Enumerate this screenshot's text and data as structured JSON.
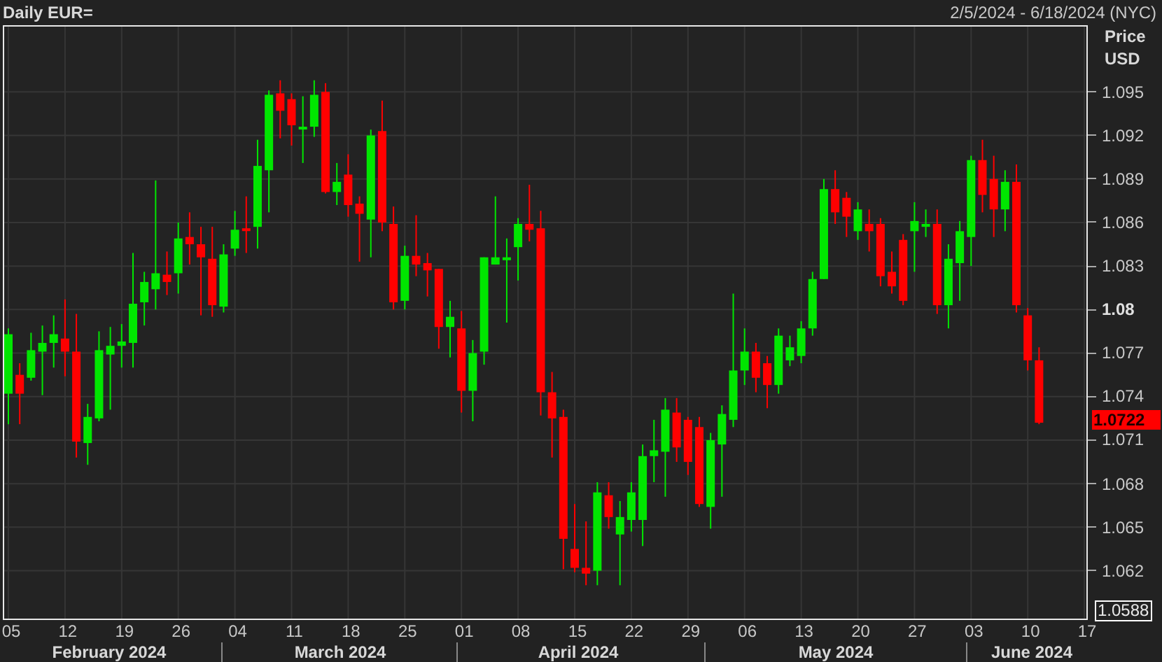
{
  "header": {
    "title": "Daily EUR=",
    "range": "2/5/2024 - 6/18/2024 (NYC)"
  },
  "price_axis": {
    "title": "Price",
    "unit": "USD",
    "tick_styles": [
      {
        "major": false
      },
      {
        "major": false
      },
      {
        "major": false
      },
      {
        "major": false
      },
      {
        "major": false
      },
      {
        "major": true
      },
      {
        "major": false
      },
      {
        "major": false
      },
      {
        "major": false
      },
      {
        "major": false
      },
      {
        "major": false
      },
      {
        "major": false
      }
    ],
    "last_price": "1.0722",
    "low_marker": "1.0588"
  },
  "chart_data": {
    "type": "candlestick",
    "categories": [
      "05",
      null,
      null,
      null,
      null,
      "12",
      null,
      null,
      null,
      null,
      "19",
      null,
      null,
      null,
      null,
      "26",
      null,
      null,
      null,
      null,
      "04",
      null,
      null,
      null,
      null,
      "11",
      null,
      null,
      null,
      null,
      "18",
      null,
      null,
      null,
      null,
      "25",
      null,
      null,
      null,
      null,
      "01",
      null,
      null,
      null,
      null,
      "08",
      null,
      null,
      null,
      null,
      "15",
      null,
      null,
      null,
      null,
      "22",
      null,
      null,
      null,
      null,
      "29",
      null,
      null,
      null,
      null,
      "06",
      null,
      null,
      null,
      null,
      "13",
      null,
      null,
      null,
      null,
      "20",
      null,
      null,
      null,
      null,
      "27",
      null,
      null,
      null,
      null,
      "03",
      null,
      null,
      null,
      null,
      "10",
      null
    ],
    "ylim": [
      1.0587,
      1.0995
    ],
    "grid": true,
    "yticks": [
      {
        "value": 1.095,
        "label": "1.095"
      },
      {
        "value": 1.092,
        "label": "1.092"
      },
      {
        "value": 1.089,
        "label": "1.089"
      },
      {
        "value": 1.086,
        "label": "1.086"
      },
      {
        "value": 1.083,
        "label": "1.083"
      },
      {
        "value": 1.08,
        "label": "1.08"
      },
      {
        "value": 1.077,
        "label": "1.077"
      },
      {
        "value": 1.074,
        "label": "1.074"
      },
      {
        "value": 1.071,
        "label": "1.071"
      },
      {
        "value": 1.068,
        "label": "1.068"
      },
      {
        "value": 1.065,
        "label": "1.065"
      },
      {
        "value": 1.062,
        "label": "1.062"
      }
    ],
    "ohlc": [
      [
        1.0742,
        1.0787,
        1.0721,
        1.0783
      ],
      [
        1.0755,
        1.0763,
        1.0721,
        1.0742
      ],
      [
        1.0753,
        1.0784,
        1.0751,
        1.0772
      ],
      [
        1.0771,
        1.0789,
        1.0741,
        1.0777
      ],
      [
        1.0777,
        1.0796,
        1.076,
        1.0783
      ],
      [
        1.078,
        1.0807,
        1.0754,
        1.0771
      ],
      [
        1.0771,
        1.0797,
        1.0698,
        1.0709
      ],
      [
        1.0708,
        1.0735,
        1.0693,
        1.0726
      ],
      [
        1.0725,
        1.0785,
        1.0723,
        1.0772
      ],
      [
        1.0769,
        1.0788,
        1.0731,
        1.0775
      ],
      [
        1.0775,
        1.079,
        1.076,
        1.0778
      ],
      [
        1.0777,
        1.0839,
        1.076,
        1.0804
      ],
      [
        1.0805,
        1.0826,
        1.0789,
        1.0819
      ],
      [
        1.0814,
        1.0889,
        1.08,
        1.0825
      ],
      [
        1.0824,
        1.084,
        1.081,
        1.0819
      ],
      [
        1.0825,
        1.086,
        1.0811,
        1.0849
      ],
      [
        1.085,
        1.0867,
        1.0831,
        1.0845
      ],
      [
        1.0845,
        1.0857,
        1.0796,
        1.0836
      ],
      [
        1.0835,
        1.0857,
        1.0795,
        1.0803
      ],
      [
        1.0802,
        1.0845,
        1.0798,
        1.0838
      ],
      [
        1.0842,
        1.0868,
        1.0837,
        1.0855
      ],
      [
        1.0856,
        1.0878,
        1.0839,
        1.0855
      ],
      [
        1.0857,
        1.0917,
        1.0842,
        1.0899
      ],
      [
        1.0896,
        1.0951,
        1.0867,
        1.0948
      ],
      [
        1.0949,
        1.0958,
        1.0918,
        1.0937
      ],
      [
        1.0945,
        1.0949,
        1.0913,
        1.0927
      ],
      [
        1.0925,
        1.0947,
        1.0901,
        1.0926
      ],
      [
        1.0926,
        1.0958,
        1.0919,
        1.0948
      ],
      [
        1.095,
        1.0956,
        1.088,
        1.0881
      ],
      [
        1.0881,
        1.0901,
        1.0872,
        1.0888
      ],
      [
        1.0893,
        1.0907,
        1.0864,
        1.0872
      ],
      [
        1.0873,
        1.0878,
        1.0833,
        1.0866
      ],
      [
        1.0862,
        1.0924,
        1.0836,
        1.092
      ],
      [
        1.0923,
        1.0944,
        1.0854,
        1.086
      ],
      [
        1.0859,
        1.0871,
        1.08,
        1.0805
      ],
      [
        1.0806,
        1.0844,
        1.08,
        1.0837
      ],
      [
        1.0837,
        1.0865,
        1.0823,
        1.0831
      ],
      [
        1.0832,
        1.0839,
        1.0809,
        1.0827
      ],
      [
        1.0828,
        1.0828,
        1.0773,
        1.0788
      ],
      [
        1.0788,
        1.0806,
        1.0767,
        1.0795
      ],
      [
        1.0787,
        1.0799,
        1.0729,
        1.0744
      ],
      [
        1.0744,
        1.0779,
        1.0723,
        1.077
      ],
      [
        1.0771,
        1.0836,
        1.0762,
        1.0836
      ],
      [
        1.0831,
        1.0878,
        1.0831,
        1.0836
      ],
      [
        1.0834,
        1.0849,
        1.0791,
        1.0836
      ],
      [
        1.0843,
        1.0863,
        1.082,
        1.0859
      ],
      [
        1.0859,
        1.0886,
        1.0847,
        1.0855
      ],
      [
        1.0856,
        1.0868,
        1.0727,
        1.0743
      ],
      [
        1.0743,
        1.0757,
        1.0698,
        1.0725
      ],
      [
        1.0726,
        1.0731,
        1.0621,
        1.0642
      ],
      [
        1.0635,
        1.0666,
        1.0619,
        1.0622
      ],
      [
        1.0622,
        1.0654,
        1.061,
        1.0618
      ],
      [
        1.062,
        1.0681,
        1.061,
        1.0674
      ],
      [
        1.0672,
        1.0681,
        1.0649,
        1.0657
      ],
      [
        1.0645,
        1.0668,
        1.061,
        1.0657
      ],
      [
        1.0655,
        1.0681,
        1.0647,
        1.0674
      ],
      [
        1.0655,
        1.0707,
        1.0637,
        1.0699
      ],
      [
        1.0699,
        1.0724,
        1.0681,
        1.0703
      ],
      [
        1.0702,
        1.0739,
        1.0671,
        1.0731
      ],
      [
        1.0729,
        1.0739,
        1.0695,
        1.0705
      ],
      [
        1.0724,
        1.0726,
        1.0686,
        1.0695
      ],
      [
        1.0719,
        1.0726,
        1.0664,
        1.0666
      ],
      [
        1.0664,
        1.0715,
        1.0649,
        1.071
      ],
      [
        1.0707,
        1.0734,
        1.0671,
        1.0728
      ],
      [
        1.0724,
        1.0811,
        1.0719,
        1.0758
      ],
      [
        1.0758,
        1.0787,
        1.0748,
        1.0771
      ],
      [
        1.0771,
        1.0777,
        1.0743,
        1.0753
      ],
      [
        1.0763,
        1.0768,
        1.0732,
        1.0748
      ],
      [
        1.0748,
        1.0787,
        1.0742,
        1.0782
      ],
      [
        1.0765,
        1.0782,
        1.0761,
        1.0774
      ],
      [
        1.0768,
        1.0792,
        1.0763,
        1.0787
      ],
      [
        1.0787,
        1.0826,
        1.0782,
        1.0821
      ],
      [
        1.0821,
        1.089,
        1.0821,
        1.0883
      ],
      [
        1.0883,
        1.0896,
        1.0859,
        1.0867
      ],
      [
        1.0877,
        1.0881,
        1.085,
        1.0864
      ],
      [
        1.0854,
        1.0874,
        1.0848,
        1.0869
      ],
      [
        1.0859,
        1.0869,
        1.084,
        1.0854
      ],
      [
        1.0859,
        1.0863,
        1.0816,
        1.0823
      ],
      [
        1.0826,
        1.084,
        1.0811,
        1.0816
      ],
      [
        1.0848,
        1.0852,
        1.0803,
        1.0806
      ],
      [
        1.0854,
        1.0874,
        1.0826,
        1.0861
      ],
      [
        1.0857,
        1.0869,
        1.085,
        1.0859
      ],
      [
        1.0859,
        1.0869,
        1.0797,
        1.0803
      ],
      [
        1.0803,
        1.0845,
        1.0787,
        1.0835
      ],
      [
        1.0832,
        1.0861,
        1.0806,
        1.0854
      ],
      [
        1.085,
        1.0906,
        1.083,
        1.0903
      ],
      [
        1.0903,
        1.0917,
        1.0867,
        1.0879
      ],
      [
        1.089,
        1.0906,
        1.085,
        1.0869
      ],
      [
        1.0869,
        1.0896,
        1.0854,
        1.0888
      ],
      [
        1.0888,
        1.09,
        1.0798,
        1.0803
      ],
      [
        1.0796,
        1.0801,
        1.0758,
        1.0765
      ],
      [
        1.0765,
        1.0774,
        1.0721,
        1.0722
      ]
    ]
  },
  "date_axis": {
    "trailing_day": "17",
    "months": [
      "February 2024",
      "March 2024",
      "April 2024",
      "May 2024",
      "June 2024"
    ]
  }
}
